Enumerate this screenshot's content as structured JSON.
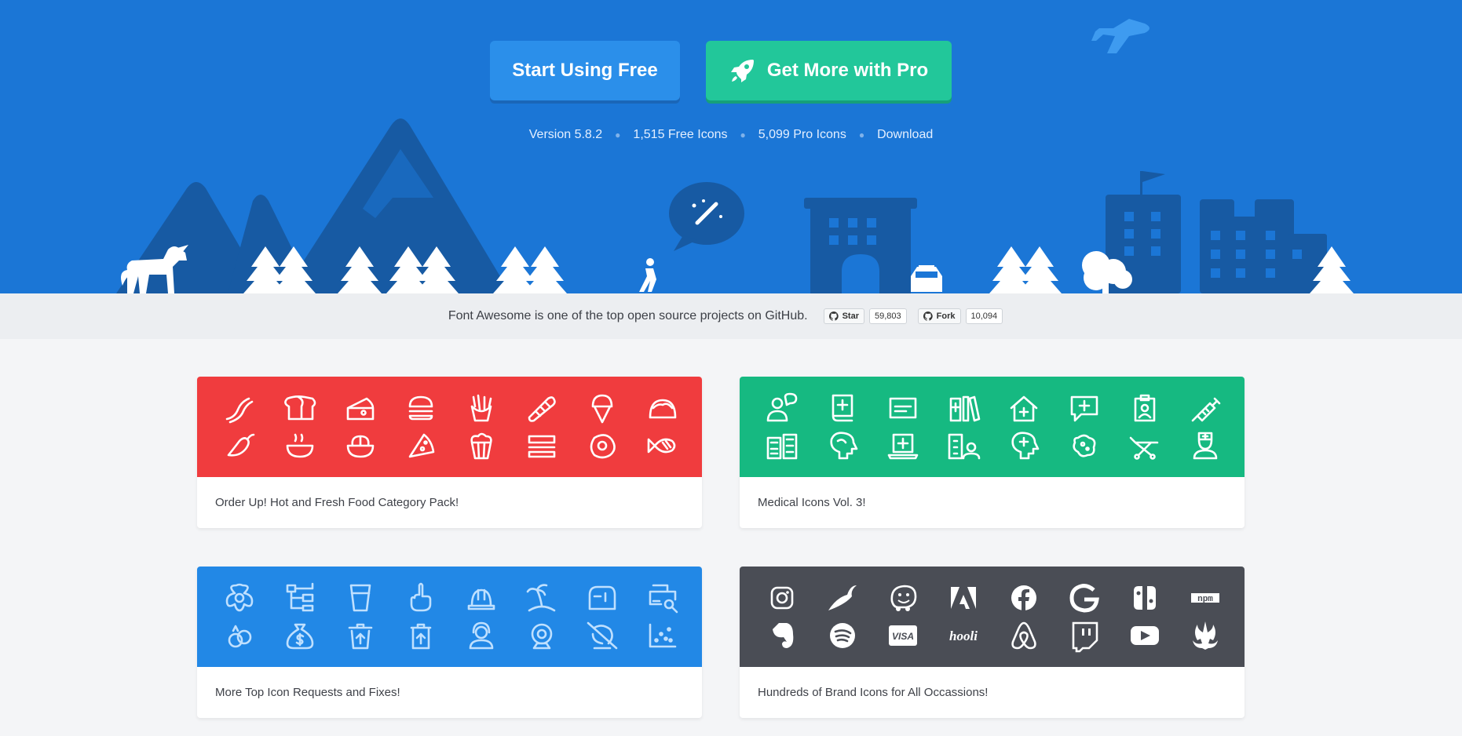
{
  "hero": {
    "free_button": "Start Using Free",
    "pro_button": "Get More with Pro",
    "meta": {
      "version": "Version 5.8.2",
      "free_icons": "1,515 Free Icons",
      "pro_icons": "5,099 Pro Icons",
      "download": "Download"
    }
  },
  "github": {
    "text": "Font Awesome is one of the top open source projects on GitHub.",
    "star_label": "Star",
    "star_count": "59,803",
    "fork_label": "Fork",
    "fork_count": "10,094"
  },
  "cards": [
    {
      "title": "Order Up! Hot and Fresh Food Category Pack!",
      "color": "#f03c3e",
      "icons": [
        "bacon-icon",
        "bread-slice-icon",
        "cheese-icon",
        "hamburger-icon",
        "french-fries-icon",
        "hotdog-icon",
        "ice-cream-icon",
        "taco-icon",
        "pepper-hot-icon",
        "soup-icon",
        "salad-icon",
        "pizza-slice-icon",
        "popcorn-icon",
        "sandwich-icon",
        "egg-fried-icon",
        "fish-cooked-icon"
      ]
    },
    {
      "title": "Medical Icons Vol. 3!",
      "color": "#16b981",
      "icons": [
        "user-md-chat-icon",
        "book-medical-icon",
        "id-card-icon",
        "books-medical-icon",
        "clinic-medical-icon",
        "comment-medical-icon",
        "clipboard-user-icon",
        "syringe-icon",
        "hospitals-icon",
        "head-side-brain-icon",
        "laptop-medical-icon",
        "hospital-user-icon",
        "head-side-medical-icon",
        "viruses-icon",
        "stretcher-icon",
        "user-nurse-icon"
      ]
    },
    {
      "title": "More Top Icon Requests and Fixes!",
      "color": "#2288e6",
      "icons": [
        "flower-icon",
        "sitemap-icon",
        "glass-icon",
        "hand-middle-finger-icon",
        "hard-hat-icon",
        "island-tropical-icon",
        "mailbox-icon",
        "print-search-icon",
        "rings-wedding-icon",
        "sack-dollar-icon",
        "trash-restore-icon",
        "trash-restore-alt-icon",
        "user-headset-icon",
        "webcam-icon",
        "webcam-slash-icon",
        "chart-scatter-icon"
      ]
    },
    {
      "title": "Hundreds of Brand Icons for All Occassions!",
      "color": "#4a4d55",
      "icons": [
        "instagram-icon",
        "pied-piper-icon",
        "waze-icon",
        "adobe-icon",
        "facebook-icon",
        "google-icon",
        "nintendo-switch-icon",
        "npm-icon",
        "evernote-icon",
        "spotify-icon",
        "cc-visa-icon",
        "hooli-icon",
        "airbnb-icon",
        "twitch-icon",
        "youtube-icon",
        "jedi-order-icon"
      ]
    }
  ],
  "brand_text": {
    "visa": "VISA",
    "hooli": "hooli",
    "npm": "npm"
  }
}
